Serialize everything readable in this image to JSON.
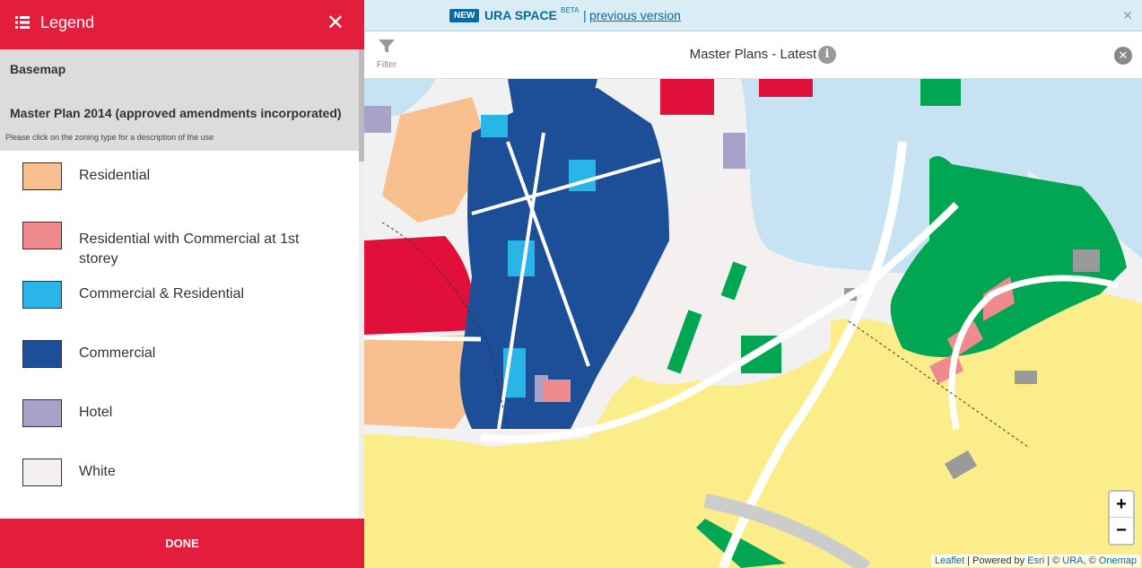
{
  "legend": {
    "title": "Legend",
    "close_symbol": "✕",
    "basemap_label": "Basemap",
    "master_plan_label": "Master Plan 2014 (approved amendments incorporated)",
    "hint": "Please click on the zoning type for a description of the use",
    "items": [
      {
        "label": "Residential",
        "color": "#f8bf8f"
      },
      {
        "label": "Residential with Commercial at 1st storey",
        "color": "#ef8a8e"
      },
      {
        "label": "Commercial & Residential",
        "color": "#29b5e8"
      },
      {
        "label": "Commercial",
        "color": "#1d4f99"
      },
      {
        "label": "Hotel",
        "color": "#a9a2c8"
      },
      {
        "label": "White",
        "color": "#f5f0f0"
      }
    ],
    "done_label": "DONE"
  },
  "banner": {
    "new_label": "NEW",
    "product": "URA SPACE",
    "beta": "BETA",
    "separator": "|",
    "previous_link": "previous version",
    "close_symbol": "✕"
  },
  "toolbar": {
    "filter_label": "Filter",
    "title": "Master Plans - Latest",
    "info_symbol": "i",
    "close_symbol": "✕"
  },
  "map": {
    "zoom_in": "+",
    "zoom_out": "−",
    "attr_leaflet": "Leaflet",
    "attr_sep1": " | Powered by ",
    "attr_esri": "Esri",
    "attr_sep2": " | © ",
    "attr_ura": "URA",
    "attr_sep3": ", © ",
    "attr_onemap": "Onemap",
    "colors": {
      "residential": "#f8bf8f",
      "res_commercial": "#ef8a8e",
      "commercial_residential": "#29b5e8",
      "commercial": "#1d4f99",
      "hotel": "#a9a2c8",
      "white": "#f5f0f0",
      "park": "#00a651",
      "water": "#c7e3f3",
      "reserve": "#fbee8a",
      "civic": "#e0103a",
      "utility": "#9a9a9a",
      "road": "#ffffff"
    }
  }
}
